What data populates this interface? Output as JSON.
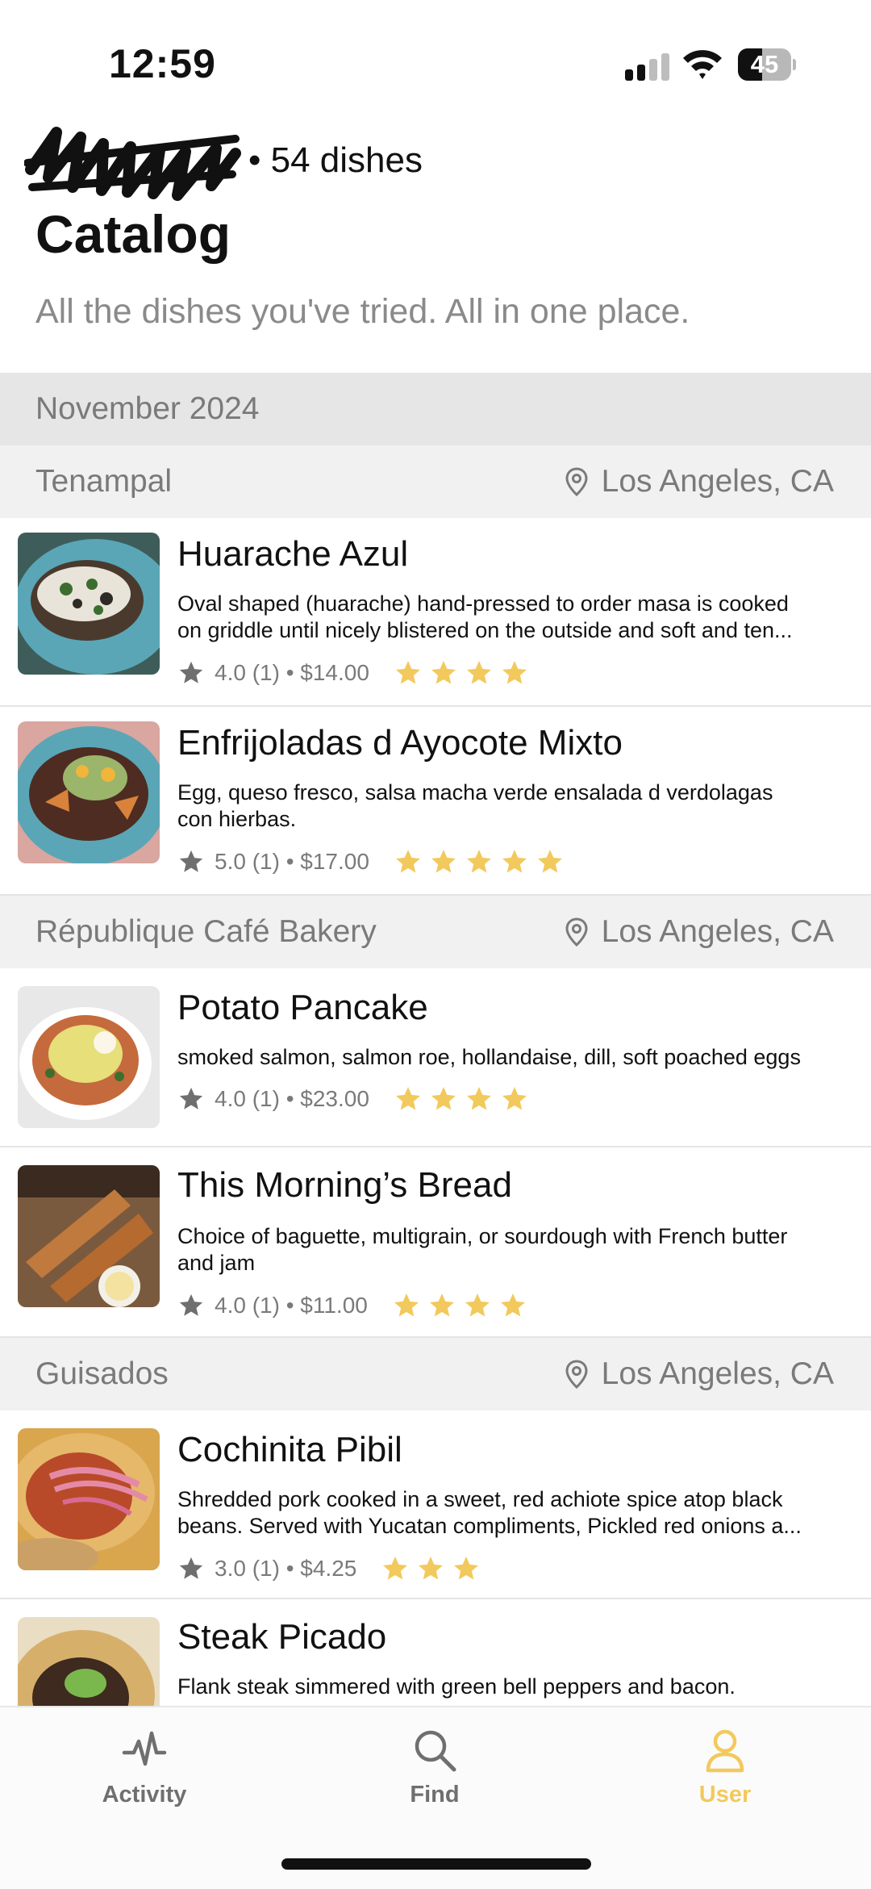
{
  "status_bar": {
    "time": "12:59",
    "battery_level": "45",
    "battery_fraction": 0.45,
    "signal_bars_active": 2,
    "signal_bars_total": 4
  },
  "header": {
    "dish_count": "• 54 dishes",
    "title": "Catalog",
    "subtitle": "All the dishes you've tried. All in one place."
  },
  "sections": [
    {
      "month": "November 2024",
      "restaurants": [
        {
          "name": "Tenampal",
          "location": "Los Angeles, CA",
          "dishes": [
            {
              "name": "Huarache Azul",
              "description_lines": [
                "Oval shaped (huarache) hand-pressed to order masa is cooked",
                "on griddle until nicely blistered on the outside and soft and ten..."
              ],
              "meta": "4.0 (1) • $14.00",
              "stars": 4
            },
            {
              "name": "Enfrijoladas d Ayocote Mixto",
              "description_lines": [
                "Egg, queso fresco, salsa macha verde ensalada d verdolagas",
                "con hierbas."
              ],
              "meta": "5.0 (1) • $17.00",
              "stars": 5
            }
          ]
        },
        {
          "name": "République Café Bakery",
          "location": "Los Angeles, CA",
          "dishes": [
            {
              "name": "Potato Pancake",
              "description_lines": [
                "smoked salmon, salmon roe, hollandaise, dill, soft poached eggs"
              ],
              "meta": "4.0 (1) • $23.00",
              "stars": 4
            },
            {
              "name": "This Morning’s Bread",
              "description_lines": [
                "Choice of baguette, multigrain, or sourdough with French butter",
                "and jam"
              ],
              "meta": "4.0 (1) • $11.00",
              "stars": 4
            }
          ]
        },
        {
          "name": "Guisados",
          "location": "Los Angeles, CA",
          "dishes": [
            {
              "name": "Cochinita Pibil",
              "description_lines": [
                "Shredded pork cooked in a sweet, red achiote spice atop black",
                "beans. Served with Yucatan compliments, Pickled red onions a..."
              ],
              "meta": "3.0 (1) • $4.25",
              "stars": 3
            },
            {
              "name": "Steak Picado",
              "description_lines": [
                "Flank steak simmered with green bell peppers and bacon."
              ],
              "meta": "",
              "stars": 0
            }
          ]
        }
      ]
    }
  ],
  "tabs": [
    {
      "label": "Activity",
      "icon": "activity-icon",
      "active": false
    },
    {
      "label": "Find",
      "icon": "search-icon",
      "active": false
    },
    {
      "label": "User",
      "icon": "user-icon",
      "active": true
    }
  ],
  "colors": {
    "accent": "#f2c95c",
    "muted_text": "#7a7a7a",
    "month_bg": "#e6e6e6",
    "restaurant_bg": "#f1f1f1"
  }
}
